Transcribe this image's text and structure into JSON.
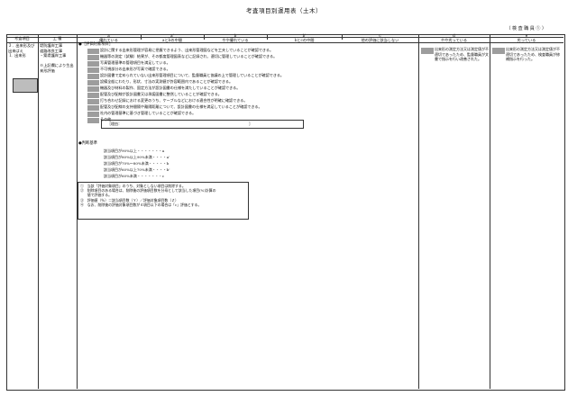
{
  "title": "考査項目別運用表（土木）",
  "sheet_no": "（ 検 査 職 員 ① ）",
  "header": {
    "category": "考査項目",
    "work_type": "工 種",
    "grades": [
      {
        "key": "a",
        "label": "優れている"
      },
      {
        "key": "a'",
        "label": "aとbの中間"
      },
      {
        "key": "b",
        "label": "やや優れている"
      },
      {
        "key": "b'",
        "label": "bとcの中間"
      },
      {
        "key": "c",
        "label": "他の評価に該当しない"
      },
      {
        "key": "d",
        "label": "やや劣っている"
      },
      {
        "key": "e",
        "label": "劣っている"
      }
    ],
    "grade_keys": [
      "a",
      "a'",
      "b",
      "b'",
      "c",
      "d",
      "e"
    ],
    "grade_labels": [
      "優れている",
      "aとbの中間",
      "やや優れている",
      "bとcの中間",
      "他の評価に該当しない",
      "やや劣っている",
      "劣っている"
    ]
  },
  "category_text": "３．出来形及び出来ばえ\n Ⅰ．出来形",
  "work_type_text": "堤防護岸工事\n道路改良工事\n・築堤護岸工事\n\n※上記欄により生出来形評価",
  "eval_heading": "●［評価対象項目］",
  "items": [
    "設計に関する出来形管理が容易に把握できるよう、出来形管理図などを工夫していることが確認できる。",
    "機器等の測定（試験）結果が、その都度管理図表などに記録され、適切に管理していることが確認できる。",
    "写真管理基準の管理項目を満足している。",
    "不可視部分の出来形が写真で確認できる。",
    "設計図書で定められていない出来形管理項目について、監督職員と協議の上で管理していることが確認できる。",
    "設備全般にわたり、形状、寸法の実測値が許容範囲内であることが確認できる。",
    "機器及び材料の製作、固定方法が設計図書の仕様を満たしていることが確認できる。",
    "配管及び配線が設計図書又は承諾図書に整然していることが確認できる。",
    "打ち合わせ記録における変更のうち、ケーブルなどにおける適合性が明確に確認できる。",
    "配管及び配線の支持間隔や離隔距離について、設計図書の仕様を満足していることが確認できる。",
    "社内の管理基準に基づき管理していることが確認できる。",
    "その他"
  ],
  "other_reason_label": "［理由：",
  "other_reason_end": "］",
  "criteria_heading": "●判断基準",
  "criteria": [
    "該当項目が90%以上・・・・・・・a",
    "該当項目が80%以上90%未満・・・・a'",
    "該当項目が70%〜80%未満・・・・・b",
    "該当項目が60%以上70%未満・・・・b'",
    "該当項目が60%未満・・・・・・・c"
  ],
  "notes": [
    "①　当該「評価対象項目」のうち、対象としない項目は削除する。",
    "②　削除項目のある場合は、削除後の評価項目数を分母として該当した項目(%)計算の",
    "　　値で評価する。",
    "③　評価値（％）＝該当項目数（Ｙ）／評価対象項目数（Ｚ）",
    "④　なお、削除後の評価対象項目数が４項目以下の場合は「c」評価とする。"
  ],
  "d_text": "出来形の測定方法又は測定値が不適切であったため、監督職員が文書で指示を行い改善された。",
  "e_text": "出来形の測定方法又は測定値が不適切であったため、検査職員が修補指示を行った。"
}
